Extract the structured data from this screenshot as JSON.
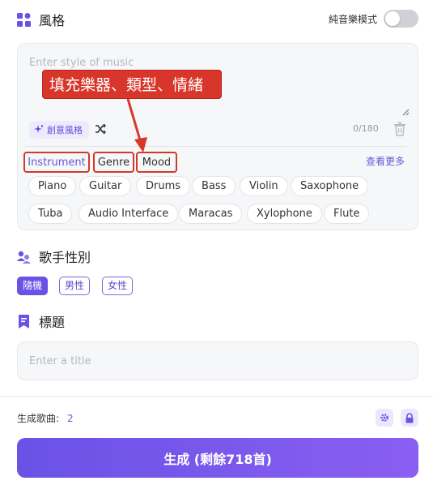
{
  "style_section": {
    "title": "風格",
    "toggle_label": "純音樂模式",
    "placeholder": "Enter style of music",
    "creative_label": "創意風格",
    "counter": "0/180",
    "tabs": [
      "Instrument",
      "Genre",
      "Mood"
    ],
    "more_label": "查看更多",
    "chips_row1": [
      "Piano",
      "Guitar",
      "Drums",
      "Bass",
      "Violin",
      "Saxophone"
    ],
    "chips_row2": [
      "Tuba",
      "Audio Interface",
      "Maracas",
      "Xylophone",
      "Flute"
    ]
  },
  "annotation": {
    "callout": "填充樂器、類型、情緒"
  },
  "gender_section": {
    "title": "歌手性別",
    "options": [
      "隨機",
      "男性",
      "女性"
    ]
  },
  "title_section": {
    "title": "標題",
    "placeholder": "Enter a title"
  },
  "footer": {
    "songs_label": "生成歌曲:",
    "songs_count": "2",
    "generate_label": "生成 (剩餘718首)"
  },
  "colors": {
    "accent": "#6a52e6",
    "annotation_red": "#d8362a"
  }
}
